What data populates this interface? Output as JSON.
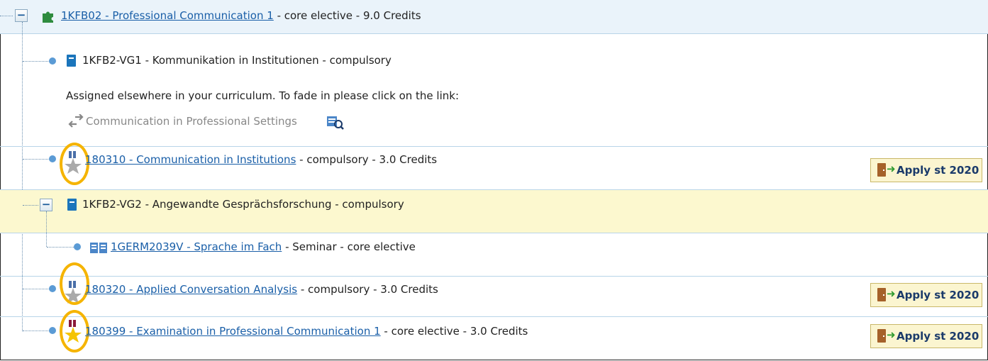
{
  "header": {
    "code_title": "1KFB02 - Professional Communication 1",
    "suffix": " - core elective - 9.0 Credits",
    "toggle": "−"
  },
  "vg1": {
    "title": "1KFB2-VG1 - Kommunikation in Institutionen - compulsory",
    "note": "Assigned elsewhere in your curriculum. To fade in please click on the link:",
    "link_label": "Communication in Professional Settings"
  },
  "items": [
    {
      "code_title": "180310 - Communication in Institutions",
      "suffix": " - compulsory - 3.0 Credits",
      "apply": "Apply st 2020"
    },
    {
      "code_title": "180320 - Applied Conversation Analysis",
      "suffix": " - compulsory - 3.0 Credits",
      "apply": "Apply st 2020"
    },
    {
      "code_title": "180399 - Examination in Professional Communication 1",
      "suffix": " - core elective - 3.0 Credits",
      "apply": "Apply st 2020"
    }
  ],
  "vg2": {
    "title": "1KFB2-VG2 - Angewandte Gesprächsforschung - compulsory",
    "toggle": "−",
    "sub": {
      "code_title": "1GERM2039V - Sprache im Fach",
      "suffix": " - Seminar - core elective"
    }
  },
  "colors": {
    "header_bg": "#eaf3fa",
    "highlight_bg": "#fcf8cf",
    "link": "#1a5fa8",
    "ring": "#f5b400"
  }
}
